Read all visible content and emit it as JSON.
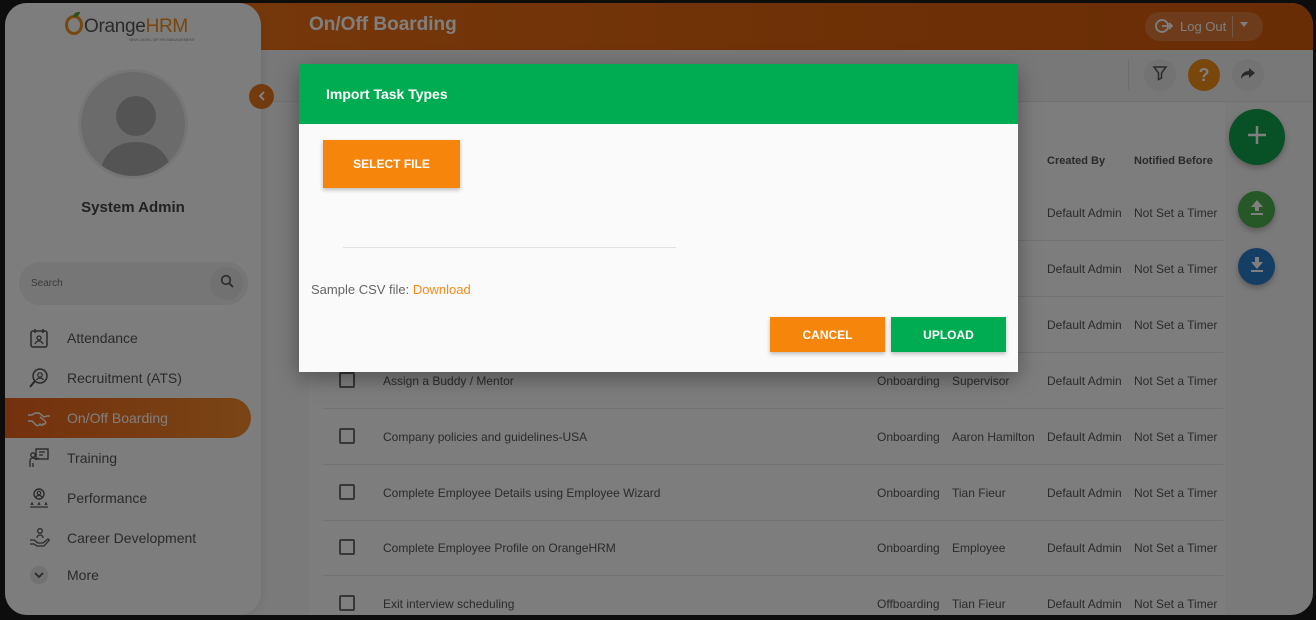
{
  "header": {
    "page_title": "On/Off Boarding",
    "logout_label": "Log Out"
  },
  "logo": {
    "brand": "Orange",
    "brand_accent": "HRM",
    "tagline": "NEW LEVEL OF HR MANAGEMENT"
  },
  "sidebar": {
    "user_name": "System Admin",
    "search_placeholder": "Search",
    "items": [
      {
        "label": "Attendance",
        "icon": "attendance-icon"
      },
      {
        "label": "Recruitment (ATS)",
        "icon": "recruitment-icon"
      },
      {
        "label": "On/Off Boarding",
        "icon": "handshake-icon",
        "active": true
      },
      {
        "label": "Training",
        "icon": "training-icon"
      },
      {
        "label": "Performance",
        "icon": "performance-icon"
      },
      {
        "label": "Career Development",
        "icon": "career-icon"
      },
      {
        "label": "More",
        "icon": "chevron-down-icon"
      }
    ]
  },
  "table": {
    "headers": {
      "created_by": "Created By",
      "notified_before": "Notified Before"
    },
    "rows": [
      {
        "name": "",
        "type": "",
        "assignee": "",
        "created_by": "Default Admin",
        "notified": "Not Set a Timer"
      },
      {
        "name": "",
        "type": "",
        "assignee": "",
        "created_by": "Default Admin",
        "notified": "Not Set a Timer"
      },
      {
        "name": "",
        "type": "",
        "assignee": "",
        "created_by": "Default Admin",
        "notified": "Not Set a Timer"
      },
      {
        "name": "Assign a Buddy / Mentor",
        "type": "Onboarding",
        "assignee": "Supervisor",
        "created_by": "Default Admin",
        "notified": "Not Set a Timer"
      },
      {
        "name": "Company policies and guidelines-USA",
        "type": "Onboarding",
        "assignee": "Aaron Hamilton",
        "created_by": "Default Admin",
        "notified": "Not Set a Timer"
      },
      {
        "name": "Complete Employee Details using Employee Wizard",
        "type": "Onboarding",
        "assignee": "Tian Fieur",
        "created_by": "Default Admin",
        "notified": "Not Set a Timer"
      },
      {
        "name": "Complete Employee Profile on OrangeHRM",
        "type": "Onboarding",
        "assignee": "Employee",
        "created_by": "Default Admin",
        "notified": "Not Set a Timer"
      },
      {
        "name": "Exit interview scheduling",
        "type": "Offboarding",
        "assignee": "Tian Fieur",
        "created_by": "Default Admin",
        "notified": "Not Set a Timer"
      }
    ]
  },
  "modal": {
    "title": "Import Task Types",
    "select_file_label": "SELECT FILE",
    "sample_label": "Sample CSV file:",
    "download_label": "Download",
    "cancel_label": "CANCEL",
    "upload_label": "UPLOAD"
  },
  "colors": {
    "brand_orange": "#f28c18",
    "modal_green": "#00ac51",
    "fab_blue": "#2a7cc8"
  }
}
